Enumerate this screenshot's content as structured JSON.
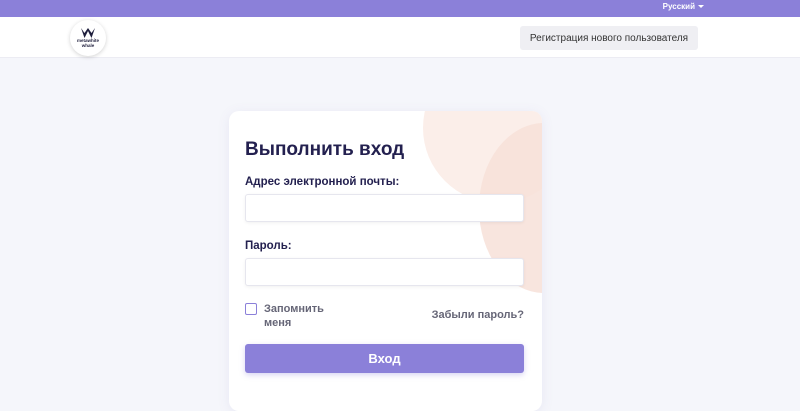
{
  "topbar": {
    "language": "Русский",
    "language_icon": "caret-down-icon",
    "color": "#8b80d9"
  },
  "header": {
    "logo_text_line1": "metawhite",
    "logo_text_line2": "whale",
    "logo_icon": "whale-tail-icon",
    "register_label": "Регистрация нового пользователя"
  },
  "login": {
    "title": "Выполнить вход",
    "email_label": "Адрес электронной почты:",
    "email_value": "",
    "password_label": "Пароль:",
    "password_value": "",
    "remember_label": "Запомнить меня",
    "remember_checked": false,
    "forgot_label": "Забыли пароль?",
    "submit_label": "Вход",
    "accent_color": "#8b80d9",
    "title_color": "#23204f"
  }
}
